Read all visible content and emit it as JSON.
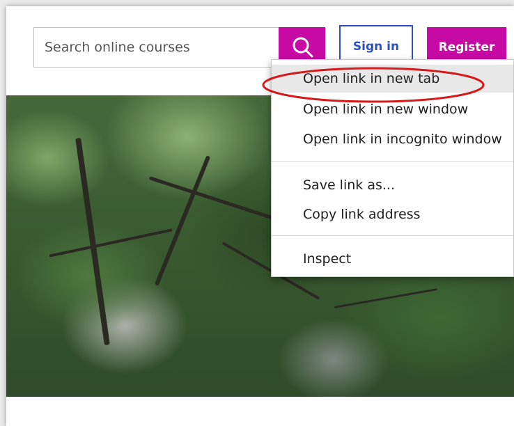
{
  "header": {
    "search_placeholder": "Search online courses",
    "signin_label": "Sign in",
    "register_label": "Register",
    "brand_color": "#c80aa5",
    "signin_color": "#2c4fc4"
  },
  "context_menu": {
    "items": [
      {
        "label": "Open link in new tab"
      },
      {
        "label": "Open link in new window"
      },
      {
        "label": "Open link in incognito window"
      },
      {
        "label": "Save link as..."
      },
      {
        "label": "Copy link address"
      },
      {
        "label": "Inspect"
      }
    ],
    "highlight_color": "#e8e8e8",
    "annotation_color": "#d61a1a"
  }
}
